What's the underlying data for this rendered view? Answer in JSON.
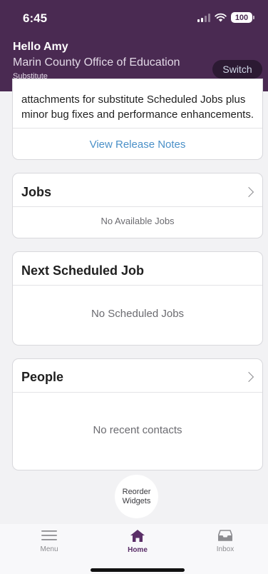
{
  "status_bar": {
    "time": "6:45",
    "battery": "100"
  },
  "header": {
    "greeting": "Hello Amy",
    "organization": "Marin County Office of Education",
    "role": "Substitute",
    "switch_label": "Switch"
  },
  "release": {
    "text": "attachments for substitute Scheduled Jobs plus minor bug fixes and performance enhancements.",
    "link_label": "View Release Notes"
  },
  "jobs": {
    "title": "Jobs",
    "empty": "No Available Jobs"
  },
  "next_job": {
    "title": "Next Scheduled Job",
    "empty": "No Scheduled Jobs"
  },
  "people": {
    "title": "People",
    "empty": "No recent contacts"
  },
  "reorder": {
    "line1": "Reorder",
    "line2": "Widgets"
  },
  "tabs": [
    {
      "label": "Menu",
      "icon": "menu-icon",
      "active": false
    },
    {
      "label": "Home",
      "icon": "home-icon",
      "active": true
    },
    {
      "label": "Inbox",
      "icon": "inbox-icon",
      "active": false
    }
  ],
  "colors": {
    "brand": "#4a2a52",
    "link": "#4a90c8",
    "active_tab": "#5a2e67"
  }
}
